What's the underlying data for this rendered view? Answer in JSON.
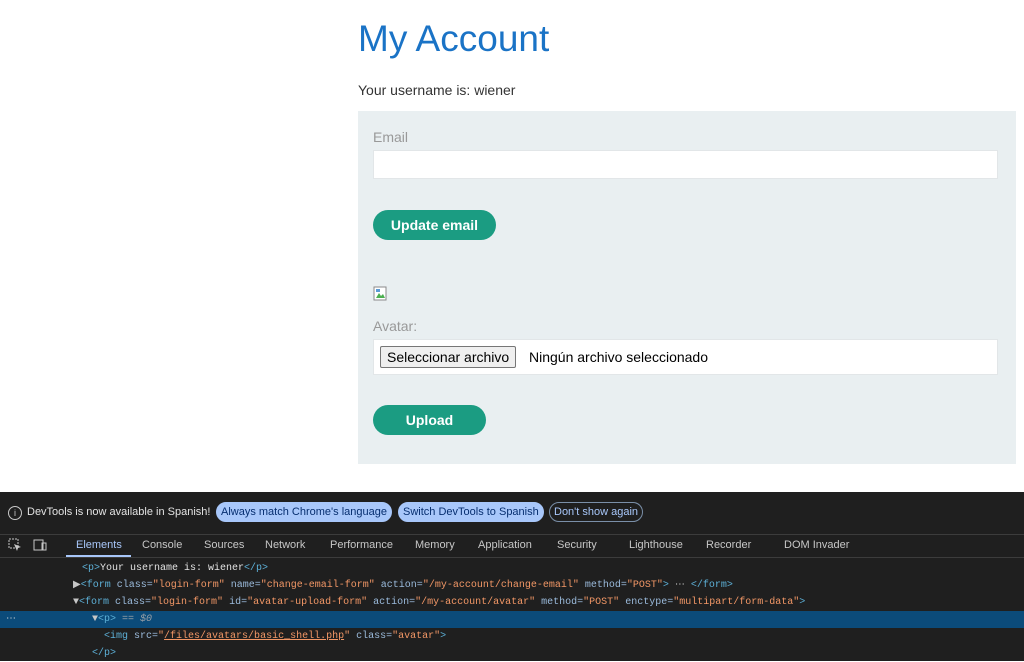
{
  "page": {
    "title": "My Account",
    "username_text": "Your username is: wiener",
    "email_label": "Email",
    "email_value": "",
    "update_email_label": "Update email",
    "avatar_label": "Avatar:",
    "file_button_label": "Seleccionar archivo",
    "file_status": "Ningún archivo seleccionado",
    "upload_label": "Upload"
  },
  "devtools": {
    "info_text": "DevTools is now available in Spanish!",
    "match_language": "Always match Chrome's language",
    "switch_language": "Switch DevTools to Spanish",
    "dont_show": "Don't show again",
    "tabs": [
      "Elements",
      "Console",
      "Sources",
      "Network",
      "Performance",
      "Memory",
      "Application",
      "Security",
      "Lighthouse",
      "Recorder",
      "DOM Invader"
    ],
    "code": {
      "l1_text": "Your username is: wiener",
      "l2_class": "\"login-form\"",
      "l2_name": "\"change-email-form\"",
      "l2_action": "\"/my-account/change-email\"",
      "l2_method": "\"POST\"",
      "l3_class": "\"login-form\"",
      "l3_id": "\"avatar-upload-form\"",
      "l3_action": "\"/my-account/avatar\"",
      "l3_method": "\"POST\"",
      "l3_enctype": "\"multipart/form-data\"",
      "l4_marker": "== $0",
      "l5_src": "/files/avatars/basic_shell.php",
      "l5_class": "\"avatar\""
    }
  },
  "colors": {
    "title": "#1a73c6",
    "button": "#1b9c82",
    "panel": "#e9eff1",
    "devtools_bg": "#1f1f1f",
    "selected_row": "#0b4b7a"
  }
}
